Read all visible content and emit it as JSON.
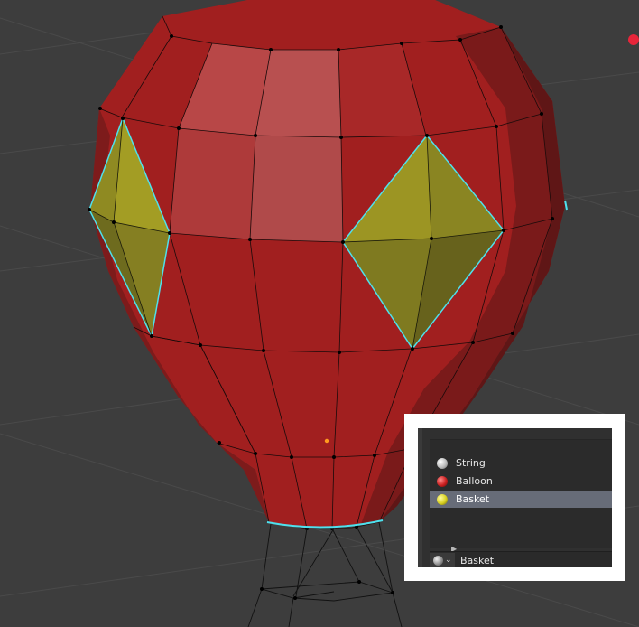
{
  "viewport": {
    "scene": "hot-air-balloon-mesh",
    "colors": {
      "background": "#3d3d3d",
      "balloon": "#a82020",
      "highlight": "#b55050",
      "basket": "#8a8a1f",
      "selection_outline": "#4ee1ee",
      "light": "#e8253a"
    }
  },
  "material_panel": {
    "slots": [
      {
        "name": "String",
        "sphere_color": "#e0e0e0",
        "selected": false
      },
      {
        "name": "Balloon",
        "sphere_color": "#cc2020",
        "selected": false
      },
      {
        "name": "Basket",
        "sphere_color": "#d8d020",
        "selected": true
      }
    ],
    "expand_icon": "triangle-right-icon",
    "browse_icon": "material-sphere-icon",
    "browse_chevron": "⌄",
    "active_material": "Basket"
  }
}
